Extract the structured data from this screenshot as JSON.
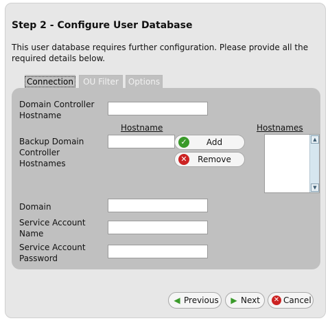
{
  "header": {
    "title": "Step 2 - Configure User Database",
    "description": "This user database requires further configuration. Please provide all the required details below."
  },
  "tabs": [
    {
      "label": "Connection",
      "active": true
    },
    {
      "label": "OU Filter",
      "active": false
    },
    {
      "label": "Options",
      "active": false
    }
  ],
  "form": {
    "dc_hostname_label": "Domain Controller Hostname",
    "dc_hostname_value": "",
    "backup_label": "Backup Domain Controller Hostnames",
    "hostname_col_header": "Hostname",
    "hostnames_col_header": "Hostnames",
    "backup_input_value": "",
    "add_label": "Add",
    "remove_label": "Remove",
    "domain_label": "Domain",
    "domain_value": "",
    "service_account_name_label": "Service Account Name",
    "service_account_name_value": "",
    "service_account_password_label": "Service Account Password",
    "service_account_password_value": ""
  },
  "footer": {
    "previous_label": "Previous",
    "next_label": "Next",
    "cancel_label": "Cancel"
  },
  "icons": {
    "add": "check-circle-icon",
    "remove": "x-circle-icon",
    "previous": "arrow-left-icon",
    "next": "arrow-right-icon",
    "cancel": "x-circle-icon"
  },
  "colors": {
    "panel_bg": "#e7e7e7",
    "content_bg": "#c0c0c0",
    "green": "#3a9a2a",
    "red": "#cc2222"
  }
}
